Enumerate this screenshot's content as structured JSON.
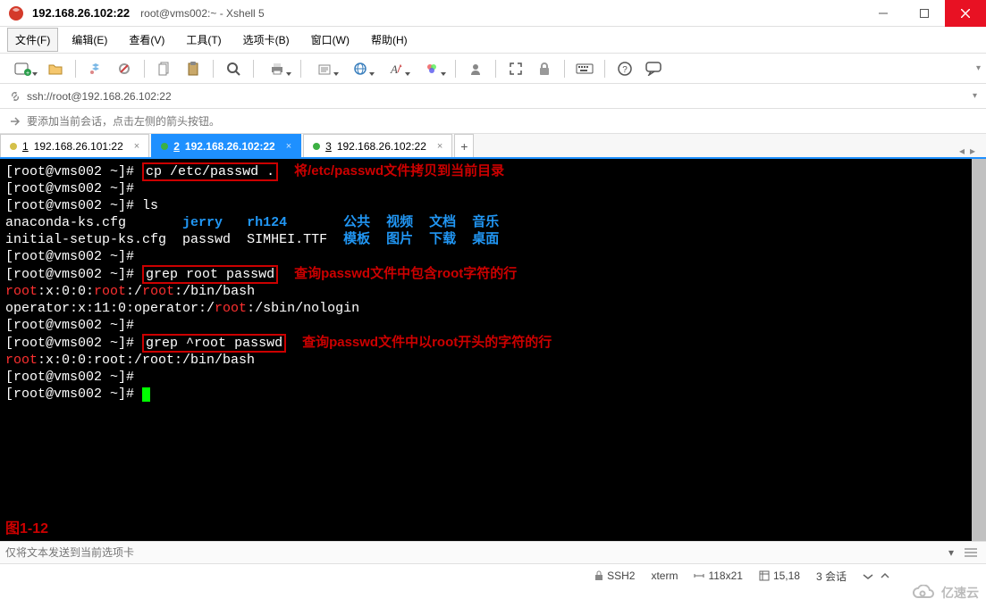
{
  "title_bar": {
    "host": "192.168.26.102:22",
    "subtitle": "root@vms002:~ - Xshell 5"
  },
  "menu": {
    "file": "文件(F)",
    "edit": "编辑(E)",
    "view": "查看(V)",
    "tools": "工具(T)",
    "tabs": "选项卡(B)",
    "window": "窗口(W)",
    "help": "帮助(H)"
  },
  "address": {
    "url": "ssh://root@192.168.26.102:22"
  },
  "hint": {
    "text": "要添加当前会话，点击左侧的箭头按钮。"
  },
  "tabs": [
    {
      "index": "1",
      "label": "192.168.26.101:22",
      "dot": "y",
      "active": false
    },
    {
      "index": "2",
      "label": "192.168.26.102:22",
      "dot": "g",
      "active": true
    },
    {
      "index": "3",
      "label": "192.168.26.102:22",
      "dot": "g",
      "active": false
    }
  ],
  "terminal": {
    "prompt": "[root@vms002 ~]#",
    "cmd1": "cp /etc/passwd .",
    "annot1": "将/etc/passwd文件拷贝到当前目录",
    "cmd_ls": "ls",
    "ls_row1": {
      "c1": "anaconda-ks.cfg",
      "c2": "jerry",
      "c3": "rh124",
      "c4": "公共",
      "c5": "视频",
      "c6": "文档",
      "c7": "音乐"
    },
    "ls_row2": {
      "c1": "initial-setup-ks.cfg",
      "c2": "passwd",
      "c3": "SIMHEI.TTF",
      "c4": "模板",
      "c5": "图片",
      "c6": "下载",
      "c7": "桌面"
    },
    "cmd2": "grep root passwd",
    "annot2": "查询passwd文件中包含root字符的行",
    "grep1_l1_p1": "root",
    "grep1_l1_p2": ":x:0:0:",
    "grep1_l1_p3": "root",
    "grep1_l1_p4": ":/",
    "grep1_l1_p5": "root",
    "grep1_l1_p6": ":/bin/bash",
    "grep1_l2_p1": "operator:x:11:0:operator:/",
    "grep1_l2_p2": "root",
    "grep1_l2_p3": ":/sbin/nologin",
    "cmd3": "grep ^root passwd",
    "annot3": "查询passwd文件中以root开头的字符的行",
    "grep2_l1_p1": "root",
    "grep2_l1_p2": ":x:0:0:root:/root:/bin/bash",
    "fig_label": "图1-12"
  },
  "status_input": {
    "placeholder": "仅将文本发送到当前选项卡"
  },
  "status_bar": {
    "proto": "SSH2",
    "term": "xterm",
    "size": "118x21",
    "pos": "15,18",
    "sessions": "3 会话"
  },
  "watermark": "亿速云"
}
